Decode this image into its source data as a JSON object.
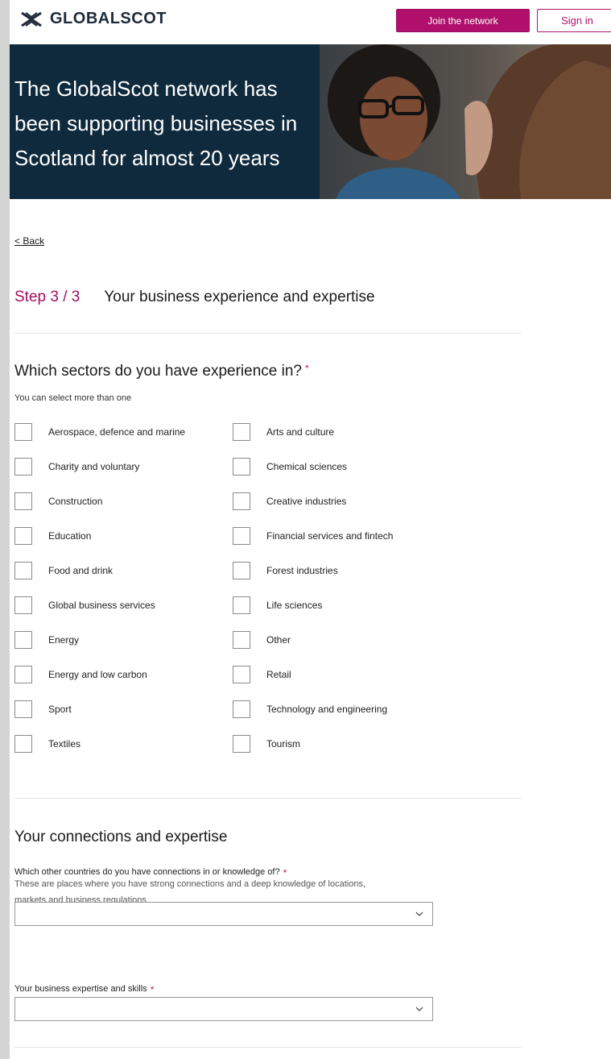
{
  "header": {
    "brand": "GLOBALSCOT",
    "join_label": "Join the network",
    "signin_label": "Sign in"
  },
  "hero": {
    "line1": "The GlobalScot network has",
    "line2": "been supporting businesses in",
    "line3": "Scotland for almost 20 years"
  },
  "back_label": "< Back",
  "step": {
    "number": "Step 3 / 3",
    "title": "Your business experience and expertise"
  },
  "sectors": {
    "heading": "Which sectors do you have experience in?",
    "required_mark": "*",
    "hint": "You can select more than one",
    "options": [
      "Aerospace, defence and marine",
      "Arts and culture",
      "Charity and voluntary",
      "Chemical sciences",
      "Construction",
      "Creative industries",
      "Education",
      "Financial services and fintech",
      "Food and drink",
      "Forest industries",
      "Global business services",
      "Life sciences",
      "Energy",
      "Other",
      "Energy and low carbon",
      "Retail",
      "Sport",
      "Technology and engineering",
      "Textiles",
      "Tourism"
    ]
  },
  "connections": {
    "heading": "Your connections and expertise",
    "countries_label": "Which other countries do you have connections in or knowledge of?",
    "countries_desc_line1": "These are places where you have strong connections and a deep knowledge of locations,",
    "countries_desc_line2": "markets and business regulations",
    "countries_value": "",
    "skills_label": "Your business expertise and skills",
    "skills_value": "",
    "required_mark": "*"
  },
  "colors": {
    "brand_magenta": "#b0106c",
    "hero_navy": "#0f2a3d"
  }
}
